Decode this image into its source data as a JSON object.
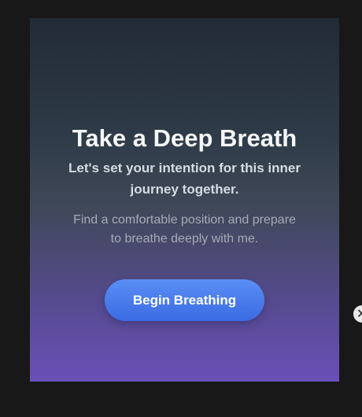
{
  "card": {
    "title": "Take a Deep Breath",
    "subtitle": "Let's set your intention for this inner journey together.",
    "hint": "Find a comfortable position and prepare to breathe deeply with me.",
    "begin_button_label": "Begin Breathing"
  },
  "close_button": {
    "icon": "close-icon",
    "glyph": "✕"
  },
  "colors": {
    "page_background": "#181818",
    "card_gradient_top": "#222b36",
    "card_gradient_bottom": "#6a4fb8",
    "button_blue": "#3b6be3",
    "title_text": "#f4f6f8"
  }
}
